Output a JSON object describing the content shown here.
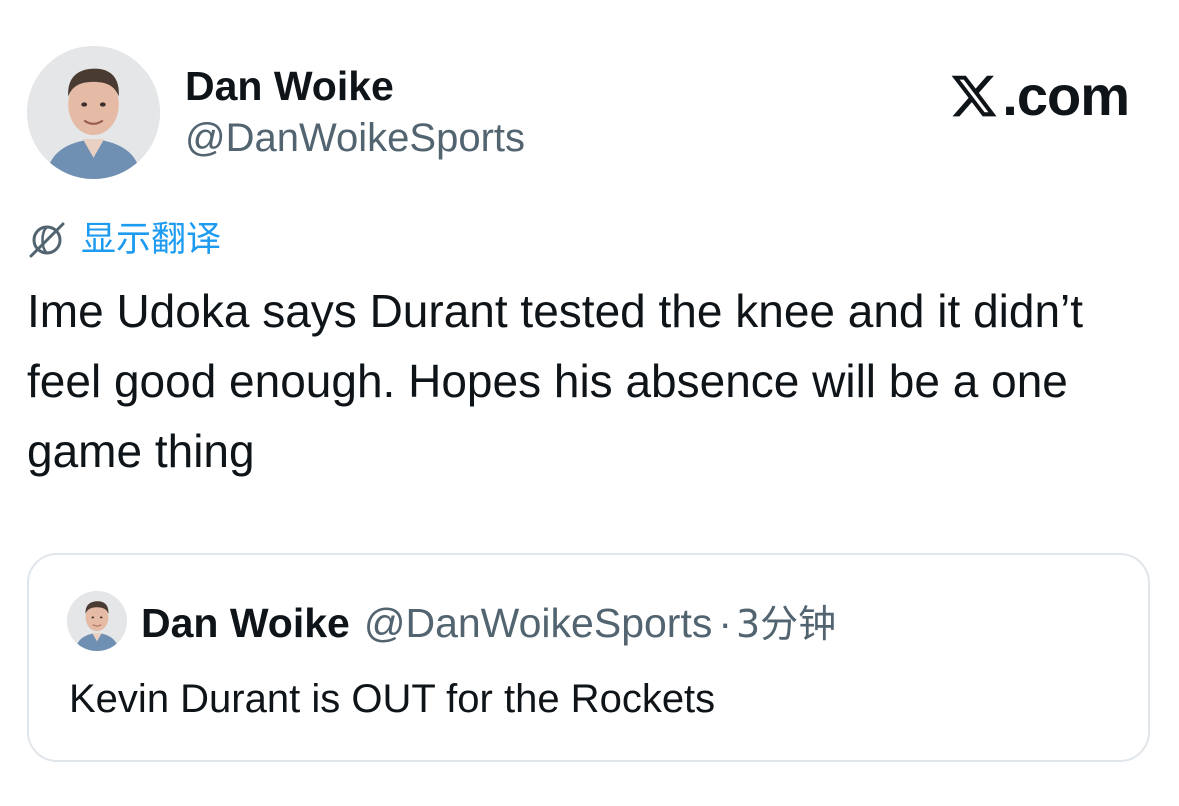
{
  "tweet": {
    "author": {
      "name": "Dan Woike",
      "handle": "@DanWoikeSports",
      "avatar_icon": "profile-photo"
    },
    "brand": {
      "logo_icon": "x-logo-icon",
      "text": ".com"
    },
    "translate": {
      "icon": "globe-slash-icon",
      "label": "显示翻译",
      "color": "#1d9bf0"
    },
    "text": "Ime Udoka says Durant tested the knee and it didn’t feel good enough. Hopes his absence will be a one game thing",
    "quote": {
      "author_name": "Dan Woike",
      "author_handle": "@DanWoikeSports",
      "separator": "·",
      "time": "3分钟",
      "text": "Kevin Durant is OUT for the Rockets"
    }
  },
  "colors": {
    "primary_text": "#0f1419",
    "secondary_text": "#536471",
    "accent": "#1d9bf0",
    "border": "#e1e6ea"
  }
}
